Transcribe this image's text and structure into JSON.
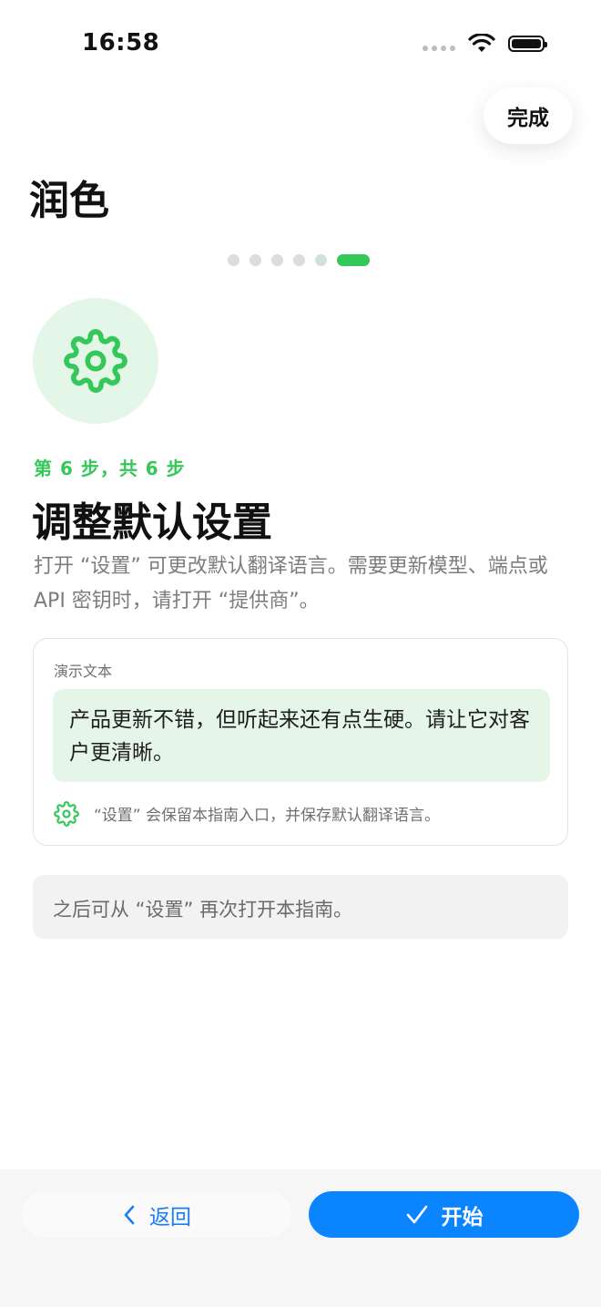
{
  "status_bar": {
    "time": "16:58"
  },
  "header": {
    "done_label": "完成",
    "app_title": "润色"
  },
  "pager": {
    "total": 6,
    "current": 6
  },
  "step": {
    "label": "第 6 步，共 6 步",
    "title": "调整默认设置",
    "description": "打开 “设置” 可更改默认翻译语言。需要更新模型、端点或 API 密钥时，请打开 “提供商”。",
    "icon": "gear-icon"
  },
  "demo": {
    "label": "演示文本",
    "text": "产品更新不错，但听起来还有点生硬。请让它对客户更清晰。",
    "footer": "“设置” 会保留本指南入口，并保存默认翻译语言。",
    "footer_icon": "gear-icon"
  },
  "note": {
    "text": "之后可从 “设置” 再次打开本指南。"
  },
  "actions": {
    "back_label": "返回",
    "start_label": "开始"
  },
  "colors": {
    "accent_green": "#34c759",
    "primary_blue": "#0a84ff"
  }
}
